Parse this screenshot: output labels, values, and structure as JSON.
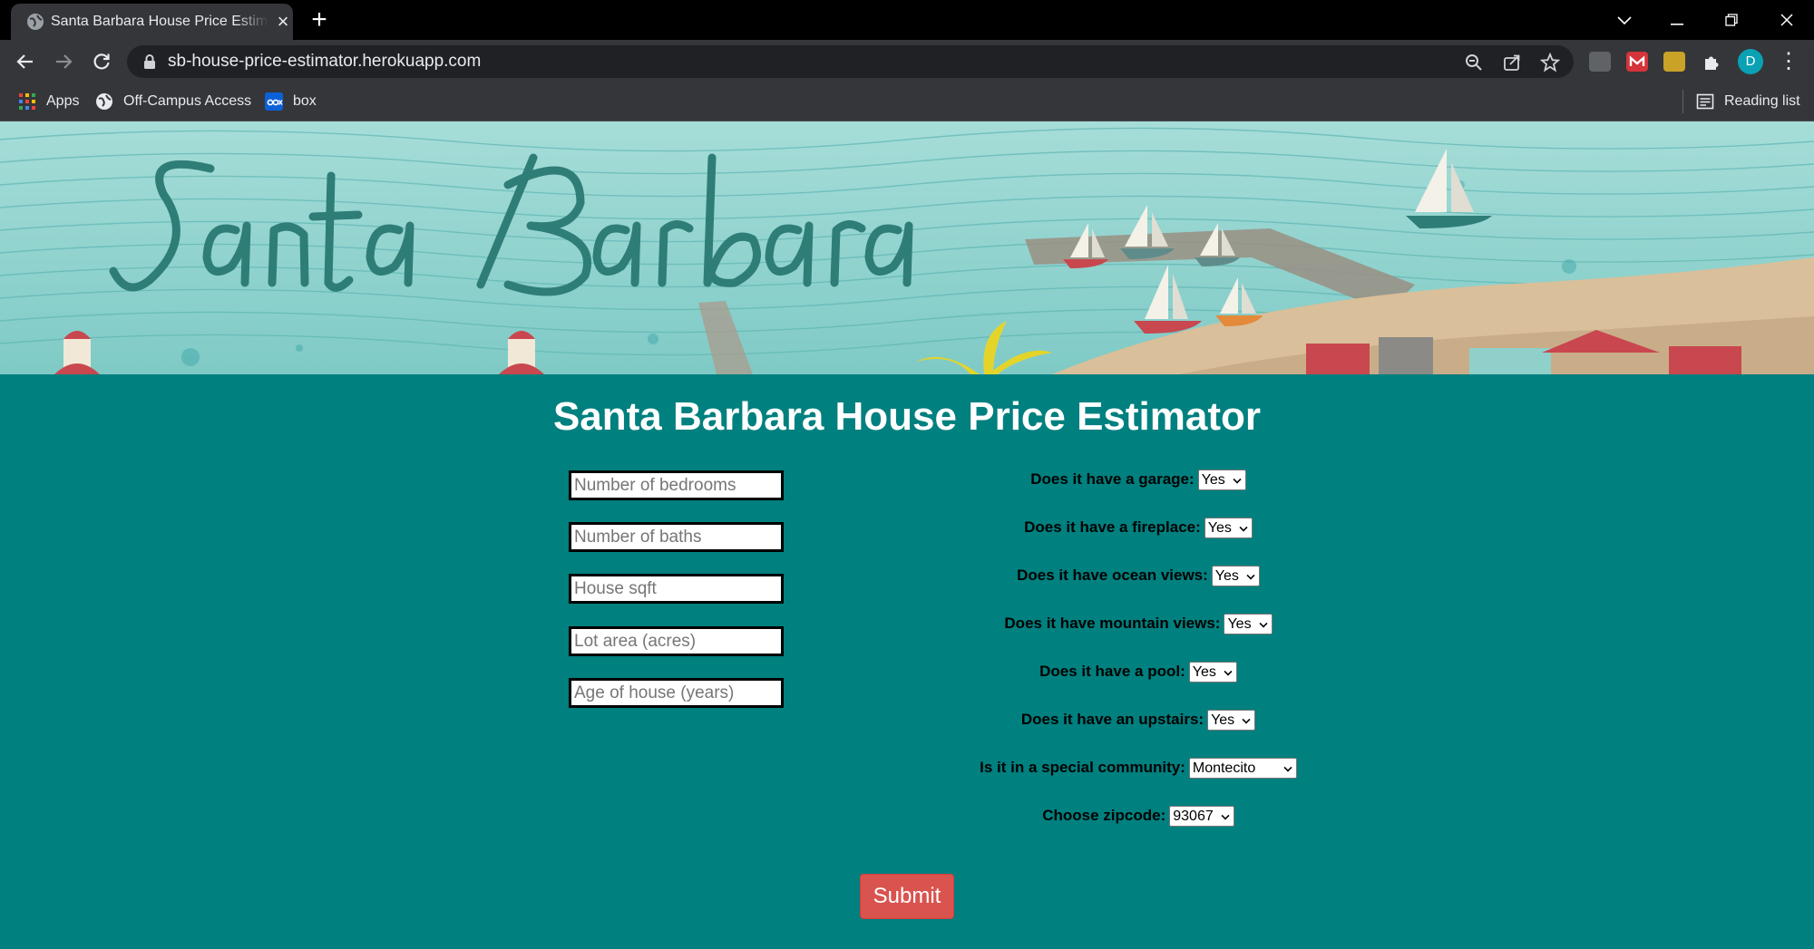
{
  "browser": {
    "tab_title": "Santa Barbara House Price Estimator",
    "url": "sb-house-price-estimator.herokuapp.com",
    "avatar_letter": "D",
    "bookmarks": [
      {
        "label": "Apps",
        "icon": "apps-grid-icon"
      },
      {
        "label": "Off-Campus Access",
        "icon": "globe-icon"
      },
      {
        "label": "box",
        "icon": "box-logo-icon"
      }
    ],
    "reading_list_label": "Reading list"
  },
  "banner": {
    "script_text": "Santa Barbara",
    "colors": {
      "sea": "#8fd3cf",
      "sand": "#d9bf9a",
      "script": "#2f7d77"
    }
  },
  "page": {
    "title": "Santa Barbara House Price Estimator",
    "inputs": [
      {
        "placeholder": "Number of bedrooms",
        "value": ""
      },
      {
        "placeholder": "Number of baths",
        "value": ""
      },
      {
        "placeholder": "House sqft",
        "value": ""
      },
      {
        "placeholder": "Lot area (acres)",
        "value": ""
      },
      {
        "placeholder": "Age of house (years)",
        "value": ""
      }
    ],
    "questions": [
      {
        "label": "Does it have a garage:",
        "selected": "Yes"
      },
      {
        "label": "Does it have a fireplace:",
        "selected": "Yes"
      },
      {
        "label": "Does it have ocean views:",
        "selected": "Yes"
      },
      {
        "label": "Does it have mountain views:",
        "selected": "Yes"
      },
      {
        "label": "Does it have a pool:",
        "selected": "Yes"
      },
      {
        "label": "Does it have an upstairs:",
        "selected": "Yes"
      },
      {
        "label": "Is it in a special community:",
        "selected": "Montecito"
      },
      {
        "label": "Choose zipcode:",
        "selected": "93067"
      }
    ],
    "submit_label": "Submit",
    "colors": {
      "background": "#00807f",
      "submit": "#d9534f"
    }
  }
}
